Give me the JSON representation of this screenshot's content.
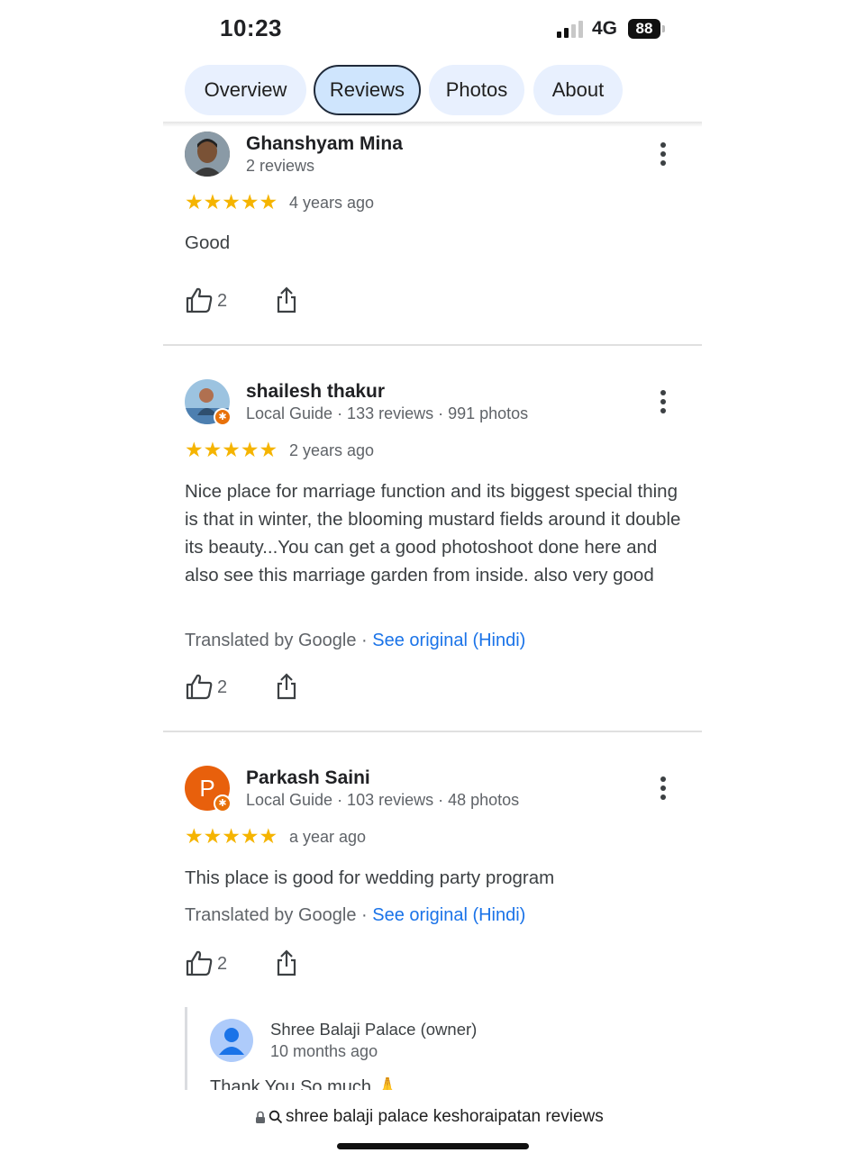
{
  "status_bar": {
    "time": "10:23",
    "network": "4G",
    "battery": "88"
  },
  "tabs": [
    {
      "label": "Overview",
      "active": false
    },
    {
      "label": "Reviews",
      "active": true
    },
    {
      "label": "Photos",
      "active": false
    },
    {
      "label": "About",
      "active": false
    }
  ],
  "reviews": [
    {
      "name": "Ghanshyam Mina",
      "meta": "2 reviews",
      "rating": 5,
      "stars": "★★★★★",
      "age": "4 years ago",
      "text": "Good",
      "likes": "2"
    },
    {
      "name": "shailesh thakur",
      "meta": "Local Guide · 133 reviews · 991 photos",
      "rating": 5,
      "stars": "★★★★★",
      "age": "2 years ago",
      "text": "Nice place for marriage function and its biggest special thing is that in winter, the blooming mustard fields around it double its beauty...You can get a good photoshoot done here and also see this marriage garden from inside. also very good",
      "translated": "Translated by Google · ",
      "see_original": "See original (Hindi)",
      "likes": "2"
    },
    {
      "name": "Parkash Saini",
      "initial": "P",
      "meta": "Local Guide · 103 reviews · 48 photos",
      "rating": 5,
      "stars": "★★★★★",
      "age": "a year ago",
      "text": "This place is good for wedding party program",
      "translated": "Translated by Google · ",
      "see_original": "See original (Hindi)",
      "likes": "2"
    }
  ],
  "owner_reply": {
    "name": "Shree Balaji Palace (owner)",
    "age": "10 months ago",
    "text": "Thank You So much 🙏"
  },
  "address_bar": {
    "text": "shree balaji palace keshoraipatan reviews"
  },
  "colors": {
    "star": "#f5b400",
    "link": "#1a73e8",
    "tab_bg": "#e8f0fe",
    "tab_active": "#cfe5fd",
    "guide_badge": "#e8710a"
  }
}
